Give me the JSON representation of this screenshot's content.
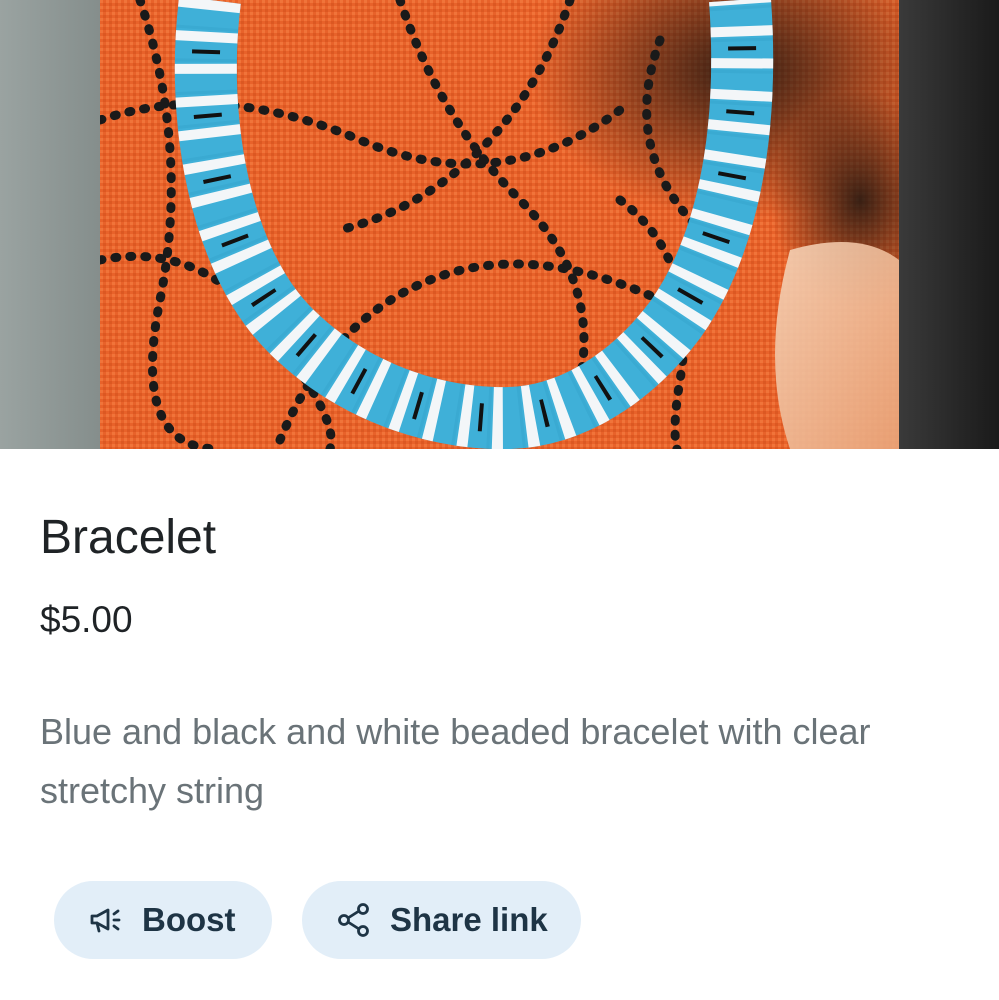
{
  "product": {
    "image_alt": "Blue, white and black heishi bead bracelet on an orange and black patterned fabric",
    "title": "Bracelet",
    "price": "$5.00",
    "description": "Blue and black and white beaded bracelet with clear stretchy string"
  },
  "actions": {
    "boost": {
      "label": "Boost",
      "icon": "megaphone-icon"
    },
    "share": {
      "label": "Share link",
      "icon": "share-icon"
    }
  },
  "colors": {
    "chip_background": "#e2eef8",
    "chip_text": "#1e3445",
    "title_text": "#1f2326",
    "description_text": "#6a7378",
    "bead_blue": "#3fb0d8",
    "fabric_orange": "#e8622a"
  }
}
